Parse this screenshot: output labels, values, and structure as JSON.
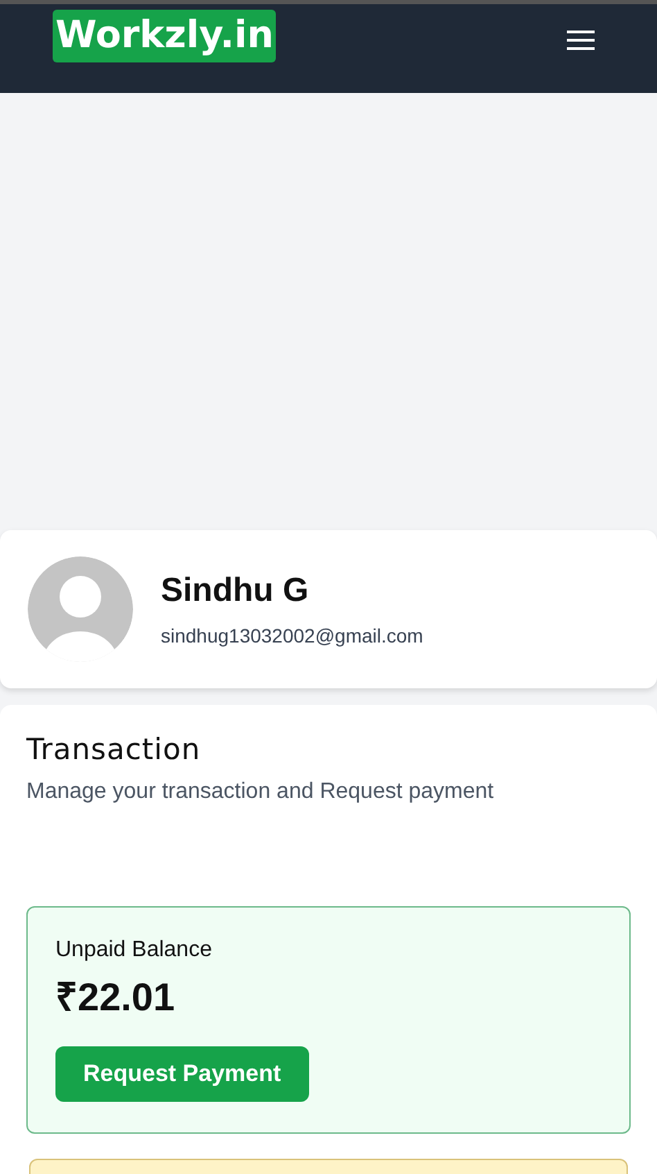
{
  "header": {
    "logo": "Workzly.in"
  },
  "profile": {
    "name": "Sindhu G",
    "email": "sindhug13032002@gmail.com"
  },
  "transaction": {
    "title": "Transaction",
    "subtitle": "Manage your transaction and Request payment"
  },
  "balance": {
    "label": "Unpaid Balance",
    "amount": "₹22.01",
    "button": "Request Payment"
  }
}
